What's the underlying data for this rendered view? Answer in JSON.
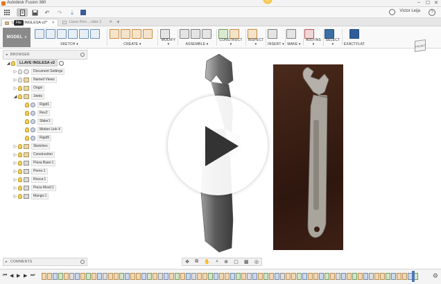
{
  "window": {
    "title": "Autodesk Fusion 360",
    "minimize": "–",
    "maximize": "☐",
    "close": "✕"
  },
  "toolbar": {
    "file_tooltip": "File",
    "user_name": "Victor Leija",
    "help_label": "?"
  },
  "tabs": [
    {
      "label": "LLAVE INGLESA v2*",
      "active": true
    },
    {
      "label": "Llave Perr... nder 2 v6*",
      "active": false
    }
  ],
  "new_tab_label": "+",
  "workspace": {
    "label": "MODEL",
    "arrow": "▾"
  },
  "ribbon_groups": [
    {
      "label": "SKETCH ▾"
    },
    {
      "label": "CREATE ▾"
    },
    {
      "label": "MODIFY ▾"
    },
    {
      "label": "ASSEMBLE ▾"
    },
    {
      "label": "CONSTRUCT ▾"
    },
    {
      "label": "INSPECT ▾"
    },
    {
      "label": "INSERT ▾"
    },
    {
      "label": "MAKE ▾"
    },
    {
      "label": "ADD-INS ▾"
    },
    {
      "label": "SELECT ▾"
    },
    {
      "label": "EXACTFLAT"
    }
  ],
  "viewcube": {
    "face": "FRONT"
  },
  "browser": {
    "header": "BROWSER",
    "root": "LLAVE INGLESA v2",
    "items": [
      {
        "label": "Document Settings",
        "indent": 1,
        "icon": "doc",
        "bulb": false
      },
      {
        "label": "Named Views",
        "indent": 1,
        "icon": "folder",
        "bulb": false
      },
      {
        "label": "Origin",
        "indent": 1,
        "icon": "folder",
        "bulb": true
      },
      {
        "label": "Joints",
        "indent": 1,
        "icon": "folder",
        "bulb": true,
        "expanded": true
      },
      {
        "label": "Rigid1",
        "indent": 2,
        "icon": "joint",
        "bulb": true
      },
      {
        "label": "Rev2",
        "indent": 2,
        "icon": "joint",
        "bulb": true
      },
      {
        "label": "Slider1",
        "indent": 2,
        "icon": "joint",
        "bulb": true
      },
      {
        "label": "Motion Link 4",
        "indent": 2,
        "icon": "joint",
        "bulb": true
      },
      {
        "label": "Rigid5",
        "indent": 2,
        "icon": "joint",
        "bulb": true
      },
      {
        "label": "Sketches",
        "indent": 1,
        "icon": "folder",
        "bulb": true
      },
      {
        "label": "Construction",
        "indent": 1,
        "icon": "folder",
        "bulb": true
      },
      {
        "label": "Pieza Base:1",
        "indent": 1,
        "icon": "body",
        "bulb": true
      },
      {
        "label": "Perno:1",
        "indent": 1,
        "icon": "body",
        "bulb": true
      },
      {
        "label": "Rosca:1",
        "indent": 1,
        "icon": "body",
        "bulb": true
      },
      {
        "label": "Pieza Movil:1",
        "indent": 1,
        "icon": "body",
        "bulb": true
      },
      {
        "label": "Mango:1",
        "indent": 1,
        "icon": "body",
        "bulb": true
      }
    ]
  },
  "comments": {
    "header": "COMMENTS"
  },
  "navbar": {
    "icons": [
      "✥",
      "⧉",
      "✋",
      "⌕",
      "⊕",
      "▢",
      "▦",
      "◎"
    ]
  },
  "timeline": {
    "controls": [
      "⏮",
      "◀",
      "▶",
      "▶",
      "⏭"
    ],
    "settings_icon": "⚙"
  }
}
